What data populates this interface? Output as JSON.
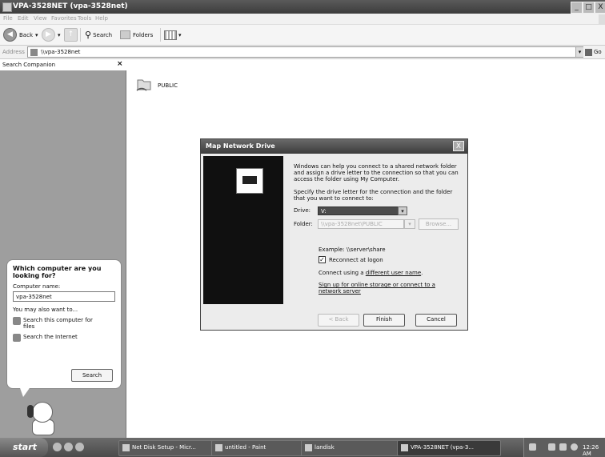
{
  "window": {
    "title": "VPA-3528NET (vpa-3528net)",
    "minimize_glyph": "_",
    "maximize_glyph": "□",
    "close_glyph": "X"
  },
  "menu": [
    "File",
    "Edit",
    "View",
    "Favorites",
    "Tools",
    "Help"
  ],
  "toolbar": {
    "back_label": "Back",
    "search_label": "Search",
    "folders_label": "Folders",
    "arrow_glyph": "▾"
  },
  "address": {
    "label": "Address",
    "value": "\\\\vpa-3528net",
    "go_label": "Go"
  },
  "search_companion": {
    "title": "Search Companion",
    "close_glyph": "×",
    "question": "Which computer are you looking for?",
    "computer_name_label": "Computer name:",
    "computer_name_value": "vpa-3528net",
    "also_label": "You may also want to...",
    "options": [
      "Search this computer for files",
      "Search the Internet"
    ],
    "search_button": "Search"
  },
  "content": {
    "share_name": "PUBLIC"
  },
  "dialog": {
    "title": "Map Network Drive",
    "close_glyph": "X",
    "intro": "Windows can help you connect to a shared network folder and assign a drive letter to the connection so that you can access the folder using My Computer.",
    "instructions": "Specify the drive letter for the connection and the folder that you want to connect to:",
    "drive_label": "Drive:",
    "drive_value": "V:",
    "folder_label": "Folder:",
    "folder_value": "\\\\vpa-3528net\\PUBLIC",
    "browse_label": "Browse...",
    "example_text": "Example: \\\\server\\share",
    "reconnect_label": "Reconnect at logon",
    "reconnect_checked": true,
    "connect_prefix": "Connect using a",
    "connect_link": "different user name",
    "signup_link": "Sign up for online storage or connect to a network server",
    "back_button": "< Back",
    "finish_button": "Finish",
    "cancel_button": "Cancel"
  },
  "taskbar": {
    "start_label": "start",
    "tasks": [
      "Net Disk Setup - Micr...",
      "untitled - Paint",
      "landisk",
      "VPA-3528NET (vpa-3..."
    ],
    "clock": "12:26 AM"
  }
}
